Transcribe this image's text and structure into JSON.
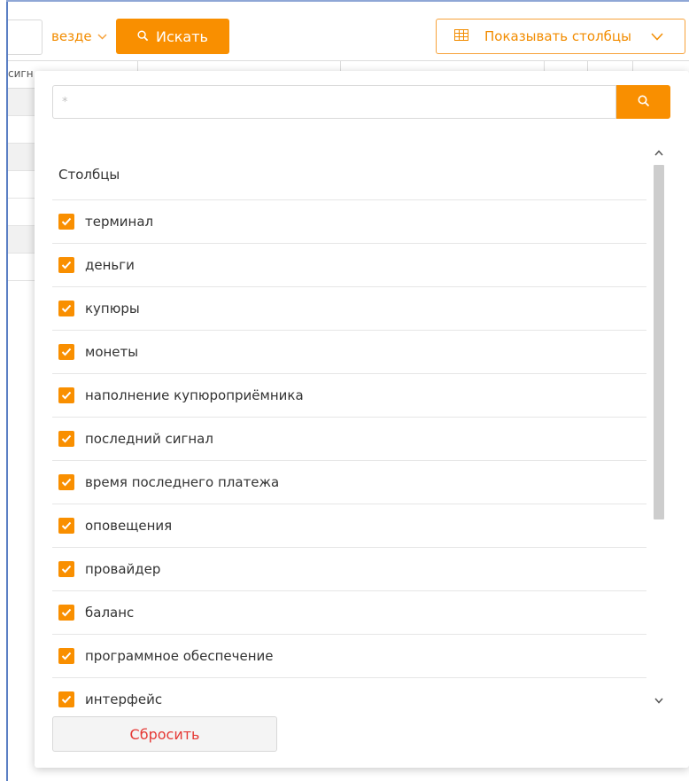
{
  "toolbar": {
    "scope_label": "везде",
    "search_button": "Искать",
    "columns_button": "Показывать столбцы"
  },
  "table": {
    "header_partial": "сигн"
  },
  "columns_panel": {
    "filter_placeholder": "*",
    "title": "Столбцы",
    "items": [
      {
        "label": "терминал",
        "checked": true
      },
      {
        "label": "деньги",
        "checked": true
      },
      {
        "label": "купюры",
        "checked": true
      },
      {
        "label": "монеты",
        "checked": true
      },
      {
        "label": "наполнение купюроприёмника",
        "checked": true
      },
      {
        "label": "последний сигнал",
        "checked": true
      },
      {
        "label": "время последнего платежа",
        "checked": true
      },
      {
        "label": "оповещения",
        "checked": true
      },
      {
        "label": "провайдер",
        "checked": true
      },
      {
        "label": "баланс",
        "checked": true
      },
      {
        "label": "программное обеспечение",
        "checked": true
      },
      {
        "label": "интерфейс",
        "checked": true
      }
    ],
    "reset_button": "Сбросить"
  },
  "icons": {
    "search": "search-icon",
    "columns": "grid-icon",
    "chevron": "chevron-down-icon",
    "check": "check-icon"
  },
  "colors": {
    "accent": "#f98f00",
    "reset_text": "#e53935",
    "frame": "#5b7fc4"
  }
}
